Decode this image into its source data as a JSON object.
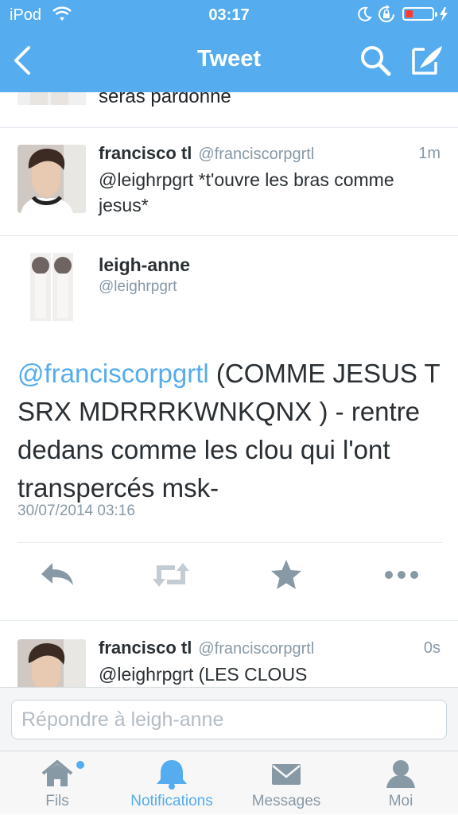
{
  "status_bar": {
    "carrier": "iPod",
    "time": "03:17"
  },
  "nav": {
    "title": "Tweet"
  },
  "previous_tweet": {
    "text": "seras pardonne"
  },
  "reply_tweet": {
    "name": "francisco tl",
    "handle": "@franciscorpgrtl",
    "time": "1m",
    "text": "@leighrpgrt *t'ouvre les bras comme jesus*"
  },
  "main_tweet": {
    "name": "leigh-anne",
    "handle": "@leighrpgrt",
    "mention": "@franciscorpgrtl",
    "text": " (COMME JESUS T SRX MDRRRKWNKQNX ) - rentre dedans comme les clou qui l'ont transpercés msk-",
    "date": "30/07/2014 03:16"
  },
  "next_tweet": {
    "name": "francisco tl",
    "handle": "@franciscorpgrtl",
    "time": "0s",
    "text": "@leighrpgrt (LES CLOUS"
  },
  "reply_bar": {
    "placeholder": "Répondre à leigh-anne"
  },
  "tabs": [
    {
      "label": "Fils",
      "icon": "home-icon"
    },
    {
      "label": "Notifications",
      "icon": "bell-icon"
    },
    {
      "label": "Messages",
      "icon": "envelope-icon"
    },
    {
      "label": "Moi",
      "icon": "person-icon"
    }
  ],
  "colors": {
    "brand": "#55acee",
    "text": "#292f33",
    "muted": "#8899a6",
    "battery_low": "#ff3b30"
  }
}
